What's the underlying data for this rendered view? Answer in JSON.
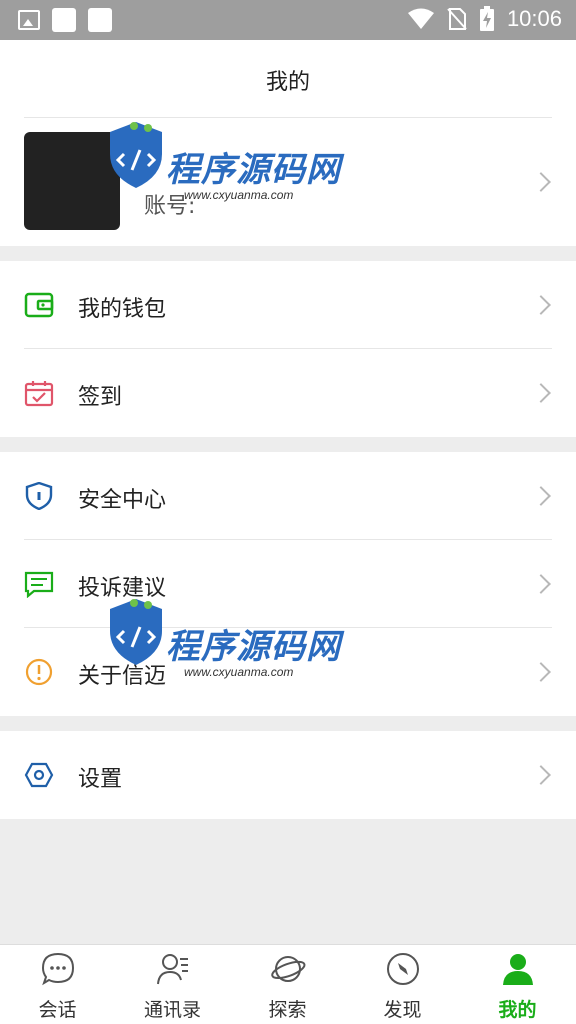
{
  "status_bar": {
    "time": "10:06"
  },
  "header": {
    "title": "我的"
  },
  "profile": {
    "account_label": "账号:"
  },
  "menu": {
    "wallet": "我的钱包",
    "checkin": "签到",
    "security": "安全中心",
    "feedback": "投诉建议",
    "about": "关于信迈",
    "settings": "设置"
  },
  "tabs": [
    {
      "label": "会话",
      "icon": "chat-bubble-icon"
    },
    {
      "label": "通讯录",
      "icon": "contacts-icon"
    },
    {
      "label": "探索",
      "icon": "planet-icon"
    },
    {
      "label": "发现",
      "icon": "compass-icon"
    },
    {
      "label": "我的",
      "icon": "person-icon",
      "active": true
    }
  ],
  "watermark": {
    "title": "程序源码网",
    "url": "www.cxyuanma.com"
  },
  "colors": {
    "accent_green": "#1aad19",
    "wallet_icon": "#1aad19",
    "checkin_icon": "#e0556a",
    "security_icon": "#1f5fa8",
    "feedback_icon": "#1aad19",
    "about_icon": "#f0a030",
    "settings_icon": "#1f5fa8"
  }
}
